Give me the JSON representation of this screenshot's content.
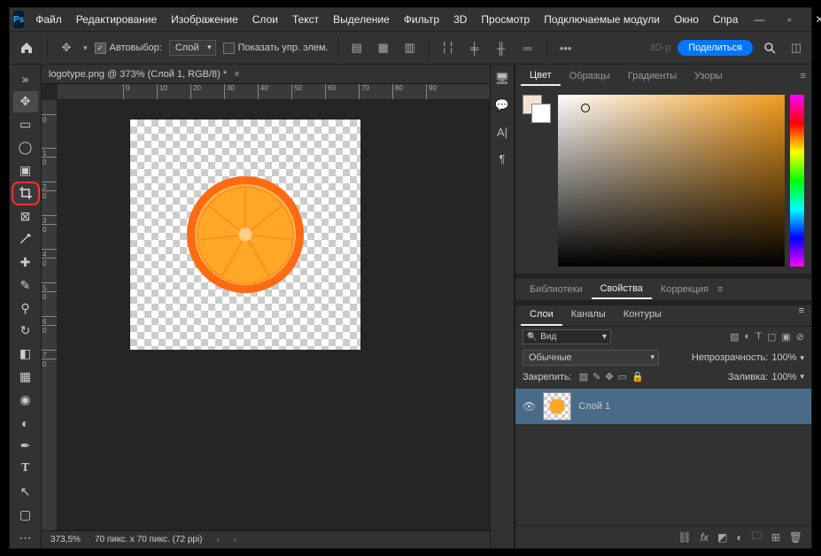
{
  "app": {
    "logo": "Ps"
  },
  "menu": {
    "file": "Файл",
    "edit": "Редактирование",
    "image": "Изображение",
    "layer": "Слои",
    "text": "Текст",
    "select": "Выделение",
    "filter": "Фильтр",
    "t3d": "3D",
    "view": "Просмотр",
    "plugins": "Подключаемые модули",
    "window": "Окно",
    "help": "Спра"
  },
  "options": {
    "autoselect_label": "Автовыбор:",
    "autoselect_target": "Слой",
    "show_transform": "Показать упр. элем.",
    "share": "Поделиться",
    "three": "3D-р"
  },
  "document": {
    "tab_title": "logotype.png @ 373% (Слой 1, RGB/8) *",
    "zoom": "373,5%",
    "size": "70 пикс. x 70 пикс. (72 ppi)"
  },
  "ruler_h": [
    "0",
    "10",
    "20",
    "30",
    "40",
    "50",
    "60",
    "70",
    "80",
    "90"
  ],
  "ruler_v": [
    "0",
    "1",
    "0",
    "2",
    "0",
    "3",
    "0",
    "4",
    "0",
    "5",
    "0",
    "6",
    "0",
    "7",
    "0"
  ],
  "midstrip_icons": [
    "🖥",
    "💬",
    "A|",
    "¶"
  ],
  "color_panel": {
    "tabs": {
      "color": "Цвет",
      "swatches": "Образцы",
      "gradients": "Градиенты",
      "patterns": "Узоры"
    }
  },
  "props_panel": {
    "tabs": {
      "lib": "Библиотеки",
      "props": "Свойства",
      "adjust": "Коррекция"
    }
  },
  "layers": {
    "tabs": {
      "layers": "Слои",
      "channels": "Каналы",
      "paths": "Контуры"
    },
    "filter": "Вид",
    "blend": "Обычные",
    "opacity_label": "Непрозрачность:",
    "opacity_value": "100%",
    "lock_label": "Закрепить:",
    "fill_label": "Заливка:",
    "fill_value": "100%",
    "layer1": "Слой 1"
  }
}
